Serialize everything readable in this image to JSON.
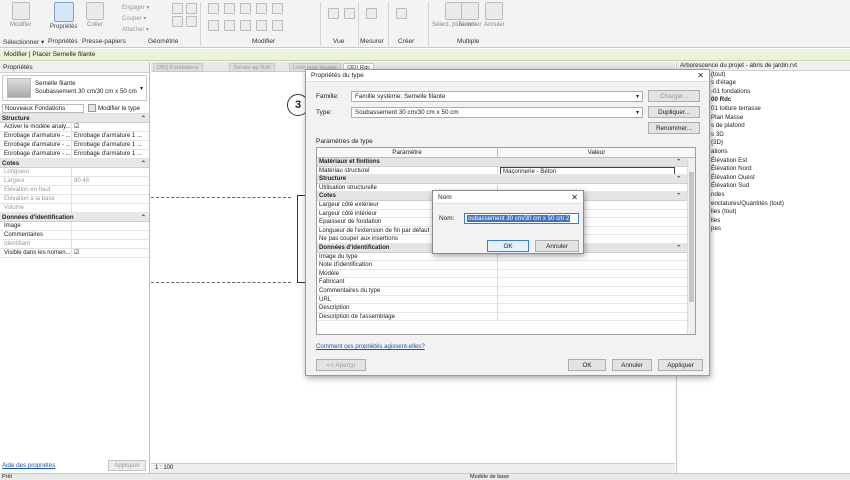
{
  "ribbon": {
    "modify": "Modifier",
    "select": "Sélectionner ▾",
    "properties": "Propriétés",
    "clipboard": "Presse-papiers",
    "paste": "Coller",
    "geom": [
      "Engager ▾",
      "Couper ▾",
      "Attacher ▾"
    ],
    "groups": [
      "Géométrie",
      "Modifier",
      "Vue",
      "Mesurer",
      "Créer",
      "Multiple"
    ],
    "multiple": [
      "Sélect. plusieurs",
      "Terminer",
      "Annuler"
    ]
  },
  "contextbar": "Modifier | Placer Semelle filante",
  "properties": {
    "title": "Propriétés",
    "type_family": "Semelle filante",
    "type_name": "Soubassement 30 cm/30 cm x 50 cm",
    "instance_filter": "Nouveaux Fondations",
    "edit_type": "Modifier le type",
    "groups": [
      {
        "name": "Structure",
        "rows": [
          {
            "label": "Activer le modèle analy...",
            "value": "☑"
          },
          {
            "label": "Enrobage d'armature - ...",
            "value": "Enrobage d'armature 1 ..."
          },
          {
            "label": "Enrobage d'armature - ...",
            "value": "Enrobage d'armature 1 ..."
          },
          {
            "label": "Enrobage d'armature - ...",
            "value": "Enrobage d'armature 1 ..."
          }
        ]
      },
      {
        "name": "Cotes",
        "rows": [
          {
            "label": "Longueur",
            "value": "",
            "grey": true
          },
          {
            "label": "Largeur",
            "value": "90.48",
            "grey": true
          },
          {
            "label": "Elévation en haut",
            "value": "",
            "grey": true
          },
          {
            "label": "Elévation à la base",
            "value": "",
            "grey": true
          },
          {
            "label": "Volume",
            "value": "",
            "grey": true
          }
        ]
      },
      {
        "name": "Données d'identification",
        "rows": [
          {
            "label": "Image",
            "value": ""
          },
          {
            "label": "Commentaires",
            "value": ""
          },
          {
            "label": "Identifiant",
            "value": "",
            "grey": true
          },
          {
            "label": "Visible dans les nomen...",
            "value": "☑"
          }
        ]
      }
    ],
    "help_link": "Aide des propriétés",
    "apply": "Appliquer"
  },
  "tabs": [
    "{3D} Fondations",
    "Terrain ap Rdc",
    "Liste type façade",
    "{3D} Rdc"
  ],
  "view_bubble": "3",
  "status_scale": "1 : 100",
  "project_browser": {
    "items": [
      "Arborescence du projet - abris de jardin.rvt",
      "(tout)",
      "s d'étage",
      "-01 fondations",
      "00 Rdc",
      "01 toiture terrasse",
      "Plan Masse",
      "s de plafond",
      "s 3D",
      "{3D}",
      "ations",
      "Élévation Est",
      "Élévation Nord",
      "Élévation Ouest",
      "Élévation Sud",
      "ndes",
      "enclatures/Quantités (tout)",
      "lles (tout)",
      "lles",
      "pes",
      "s Revit"
    ]
  },
  "bottom": {
    "left": "Prêt",
    "model": "Modèle de base"
  },
  "type_dialog": {
    "title": "Propriétés du type",
    "family_label": "Famille:",
    "family_value": "Famille système: Semelle filante",
    "type_label": "Type:",
    "type_value": "Soubassement 30 cm/30 cm x 50 cm",
    "load_btn": "Charger...",
    "duplicate_btn": "Dupliquer...",
    "rename_btn": "Renommer...",
    "params_label": "Paramètres de type",
    "col_param": "Paramètre",
    "col_value": "Valeur",
    "groups": [
      {
        "name": "Matériaux et finitions",
        "rows": [
          {
            "label": "Matériau structurel",
            "value": "Maçonnerie - Béton",
            "boxed": true
          }
        ]
      },
      {
        "name": "Structure",
        "rows": [
          {
            "label": "Utilisation structurelle",
            "value": ""
          }
        ]
      },
      {
        "name": "Cotes",
        "rows": [
          {
            "label": "Largeur côté extérieur",
            "value": ""
          },
          {
            "label": "Largeur côté intérieur",
            "value": ""
          },
          {
            "label": "Epaisseur de fondation",
            "value": ""
          },
          {
            "label": "Longueur de l'extension de fin par défaut",
            "value": ""
          },
          {
            "label": "Ne pas couper aux insertions",
            "value": ""
          }
        ]
      },
      {
        "name": "Données d'identification",
        "rows": [
          {
            "label": "Image du type",
            "value": ""
          },
          {
            "label": "Note d'identification",
            "value": ""
          },
          {
            "label": "Modèle",
            "value": ""
          },
          {
            "label": "Fabricant",
            "value": ""
          },
          {
            "label": "Commentaires du type",
            "value": ""
          },
          {
            "label": "URL",
            "value": ""
          },
          {
            "label": "Description",
            "value": ""
          },
          {
            "label": "Description de l'assemblage",
            "value": ""
          }
        ]
      }
    ],
    "help_link": "Comment ces propriétés agissent-elles?",
    "preview_btn": "<< Aperçu",
    "ok": "OK",
    "cancel": "Annuler",
    "apply": "Appliquer"
  },
  "name_dialog": {
    "title": "Nom",
    "label": "Nom:",
    "value": "oubassement 30 cm/30 cm x 50 cm 2",
    "ok": "OK",
    "cancel": "Annuler"
  }
}
